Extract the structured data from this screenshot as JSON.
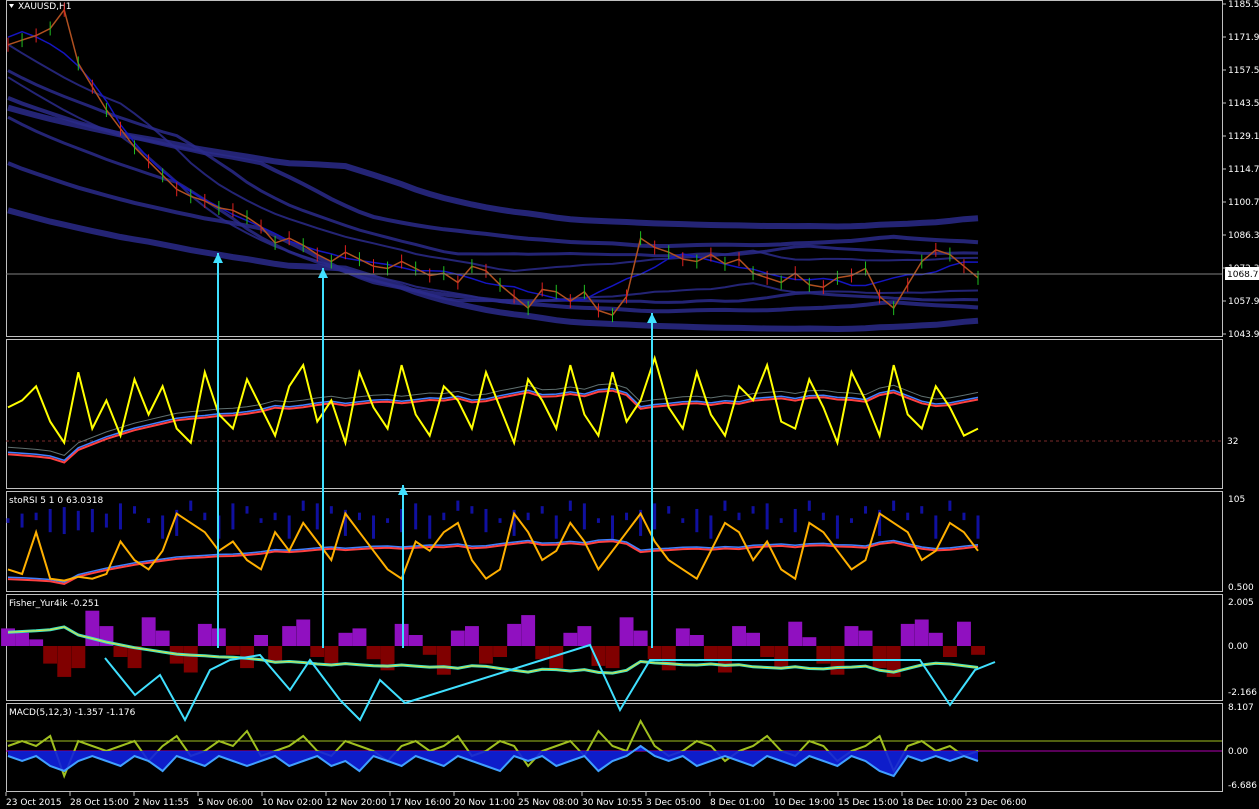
{
  "chart_data": [
    {
      "type": "line",
      "panel": "main",
      "title": "XAUUSD,H1",
      "ylim": [
        1043.9,
        1185.5
      ],
      "y_ticks": [
        "1185.50",
        "1171.90",
        "1157.50",
        "1143.50",
        "1129.10",
        "1114.70",
        "1100.70",
        "1086.30",
        "1072.30",
        "1057.90",
        "1043.90"
      ],
      "current_price": "1068.70",
      "close": [
        1168,
        1170,
        1172,
        1175,
        1183,
        1160,
        1150,
        1140,
        1132,
        1124,
        1118,
        1112,
        1106,
        1103,
        1101,
        1098,
        1097,
        1094,
        1090,
        1083,
        1085,
        1082,
        1078,
        1075,
        1079,
        1076,
        1073,
        1072,
        1075,
        1072,
        1069,
        1070,
        1066,
        1073,
        1071,
        1065,
        1060,
        1055,
        1063,
        1062,
        1058,
        1062,
        1054,
        1052,
        1060,
        1085,
        1081,
        1079,
        1076,
        1075,
        1078,
        1074,
        1076,
        1070,
        1068,
        1066,
        1070,
        1065,
        1064,
        1068,
        1069,
        1072,
        1060,
        1055,
        1065,
        1075,
        1080,
        1078,
        1073,
        1068
      ],
      "color": "#2a2a8a"
    },
    {
      "type": "line",
      "panel": "oscillator-1",
      "value_label": "32",
      "series": [
        {
          "name": "",
          "color": "#ffff00",
          "values": [
            55,
            60,
            70,
            45,
            30,
            80,
            40,
            60,
            35,
            75,
            50,
            70,
            40,
            30,
            80,
            50,
            40,
            75,
            55,
            35,
            70,
            85,
            45,
            60,
            30,
            80,
            55,
            40,
            85,
            50,
            35,
            70,
            60,
            40,
            80,
            55,
            30,
            75,
            60,
            40,
            85,
            50,
            35,
            80,
            45,
            60,
            90,
            55,
            40,
            80,
            50,
            35,
            70,
            60,
            85,
            45,
            40,
            75,
            55,
            30,
            80,
            60,
            35,
            85,
            50,
            40,
            70,
            55,
            35,
            40
          ]
        }
      ]
    },
    {
      "type": "line",
      "panel": "oscillator-2",
      "title": "stoRSI 5 1 0  63.0318",
      "y_ticks": [
        "105",
        "0.500"
      ],
      "series": [
        {
          "name": "",
          "color": "#ffb000",
          "values": [
            20,
            15,
            60,
            10,
            8,
            12,
            10,
            15,
            50,
            30,
            20,
            40,
            80,
            70,
            60,
            40,
            50,
            30,
            20,
            60,
            40,
            70,
            50,
            30,
            80,
            60,
            40,
            20,
            10,
            50,
            40,
            60,
            70,
            30,
            10,
            20,
            80,
            60,
            30,
            40,
            70,
            50,
            20,
            40,
            60,
            80,
            50,
            30,
            20,
            10,
            40,
            70,
            60,
            30,
            50,
            20,
            10,
            70,
            60,
            40,
            20,
            30,
            80,
            70,
            60,
            30,
            40,
            70,
            60,
            40
          ]
        }
      ]
    },
    {
      "type": "bar",
      "panel": "fisher",
      "title": "Fisher_Yur4ik -0.251",
      "y_ticks": [
        "2.005",
        "0.00",
        "-2.166"
      ],
      "values": [
        0.8,
        0.6,
        0.3,
        -0.8,
        -1.4,
        -1.0,
        1.6,
        0.9,
        -0.5,
        -1.0,
        1.3,
        0.7,
        -0.8,
        -1.2,
        1.0,
        0.8,
        -0.4,
        -1.0,
        0.5,
        -0.7,
        0.9,
        1.2,
        -0.5,
        -0.9,
        0.6,
        0.8,
        -0.6,
        -1.1,
        1.0,
        0.5,
        -0.4,
        -1.3,
        0.7,
        0.9,
        -0.8,
        -0.5,
        1.0,
        1.4,
        -0.6,
        -1.0,
        0.6,
        0.9,
        -0.9,
        -1.0,
        1.3,
        0.7,
        -0.6,
        -1.1,
        0.8,
        0.5,
        -0.7,
        -1.2,
        0.9,
        0.6,
        -0.5,
        -1.0,
        1.1,
        0.4,
        -0.8,
        -1.3,
        0.9,
        0.7,
        -1.0,
        -1.4,
        1.0,
        1.2,
        0.6,
        -0.5,
        1.1,
        -0.4
      ]
    },
    {
      "type": "line",
      "panel": "macd",
      "title": "MACD(5,12,3) -1.357 -1.176",
      "y_ticks": [
        "8.107",
        "0.00",
        "-6.686"
      ],
      "series": [
        {
          "name": "",
          "color": "#a0c020",
          "values": [
            1,
            2,
            1,
            3,
            -5,
            2,
            1,
            0,
            1,
            2,
            -2,
            1,
            3,
            -1,
            0,
            2,
            1,
            4,
            -1,
            0,
            1,
            3,
            0,
            -1,
            2,
            1,
            0,
            -2,
            1,
            2,
            0,
            1,
            3,
            -1,
            0,
            2,
            1,
            -3,
            0,
            1,
            2,
            -1,
            4,
            1,
            0,
            6,
            1,
            -1,
            0,
            2,
            1,
            -2,
            0,
            1,
            3,
            0,
            -1,
            2,
            1,
            -2,
            0,
            1,
            3,
            -4,
            1,
            2,
            0,
            1,
            -1,
            0
          ]
        },
        {
          "name": "",
          "color": "#40a0ff",
          "values": [
            -1,
            -2,
            -1,
            -3,
            -4,
            -2,
            -1,
            -2,
            -3,
            -1,
            -2,
            -4,
            -1,
            -2,
            -3,
            -1,
            -2,
            -3,
            -2,
            -1,
            -3,
            -2,
            -1,
            -3,
            -2,
            -4,
            -1,
            -2,
            -3,
            -1,
            -2,
            -3,
            -1,
            -2,
            -3,
            -4,
            -1,
            -2,
            -1,
            -3,
            -2,
            -1,
            -4,
            -2,
            -1,
            1,
            -1,
            -2,
            -1,
            -3,
            -2,
            -1,
            -2,
            -3,
            -1,
            -2,
            -3,
            -1,
            -2,
            -3,
            -1,
            -2,
            -4,
            -5,
            -1,
            -2,
            -1,
            -2,
            -1,
            -2
          ]
        }
      ]
    }
  ],
  "x_axis": {
    "labels": [
      "23 Oct 2015",
      "28 Oct 15:00",
      "2 Nov 11:55",
      "5 Nov 06:00",
      "10 Nov 02:00",
      "12 Nov 20:00",
      "17 Nov 16:00",
      "20 Nov 11:00",
      "25 Nov 08:00",
      "30 Nov 10:55",
      "3 Dec 05:00",
      "8 Dec 01:00",
      "10 Dec 19:00",
      "15 Dec 15:00",
      "18 Dec 10:00",
      "23 Dec 06:00"
    ]
  },
  "colors": {
    "background": "#000000",
    "border": "#c0c0c0",
    "envelope": "#2a2a8a",
    "signal_arrows": "#40e0ff"
  }
}
